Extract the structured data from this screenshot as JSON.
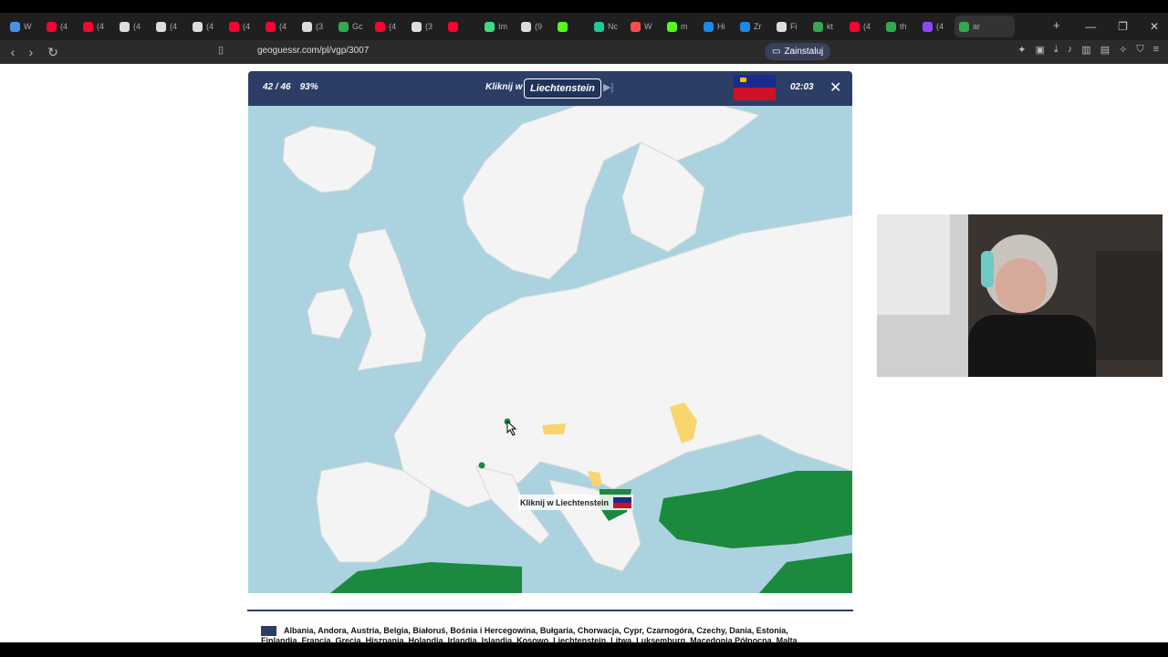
{
  "browser": {
    "tabs": [
      {
        "label": "W",
        "color": "#4a90e2"
      },
      {
        "label": "(4",
        "color": "#ff0033"
      },
      {
        "label": "(4",
        "color": "#ff0033"
      },
      {
        "label": "(4",
        "color": "#dddddd"
      },
      {
        "label": "(4",
        "color": "#dddddd"
      },
      {
        "label": "(4",
        "color": "#dddddd"
      },
      {
        "label": "(4",
        "color": "#ff0033"
      },
      {
        "label": "(4",
        "color": "#ff0033"
      },
      {
        "label": "(3",
        "color": "#dddddd"
      },
      {
        "label": "Gc",
        "color": "#34a853"
      },
      {
        "label": "(4",
        "color": "#ff0033"
      },
      {
        "label": "(3",
        "color": "#dddddd"
      },
      {
        "label": "",
        "color": "#ff0033"
      },
      {
        "label": "Im",
        "color": "#3ddc84"
      },
      {
        "label": "(9",
        "color": "#dddddd"
      },
      {
        "label": "",
        "color": "#53fc18"
      },
      {
        "label": "Nc",
        "color": "#20c997"
      },
      {
        "label": "W",
        "color": "#ff4d4d"
      },
      {
        "label": "m",
        "color": "#53fc18"
      },
      {
        "label": "Hi",
        "color": "#1e88e5"
      },
      {
        "label": "Zr",
        "color": "#1e88e5"
      },
      {
        "label": "Fi",
        "color": "#dddddd"
      },
      {
        "label": "kt",
        "color": "#34a853"
      },
      {
        "label": "(4",
        "color": "#ff0033"
      },
      {
        "label": "th",
        "color": "#34a853"
      },
      {
        "label": "(4",
        "color": "#9146ff"
      },
      {
        "label": "ar",
        "color": "#34a853"
      }
    ],
    "url": "geoguessr.com/pl/vgp/3007",
    "install_label": "Zainstaluj"
  },
  "game": {
    "progress": "42 / 46",
    "percent": "93%",
    "prompt": "Kliknij w",
    "target": "Liechtenstein",
    "timer": "02:03",
    "tooltip": "Kliknij w Liechtenstein"
  },
  "countries_text": "Albania, Andora, Austria, Belgia, Białoruś, Bośnia i Hercegowina, Bułgaria, Chorwacja, Cypr, Czarnogóra, Czechy, Dania, Estonia, Finlandia, Francja, Grecja, Hiszpania, Holandia, Irlandia, Islandia, Kosowo, Liechtenstein, Litwa, Luksemburg, Macedonia Północna, Malta, Monako",
  "colors": {
    "header": "#2c3e66",
    "sea": "#aad3df",
    "land": "#f4f4f4",
    "correct": "#1b8a3e",
    "warning": "#f9d56e"
  }
}
